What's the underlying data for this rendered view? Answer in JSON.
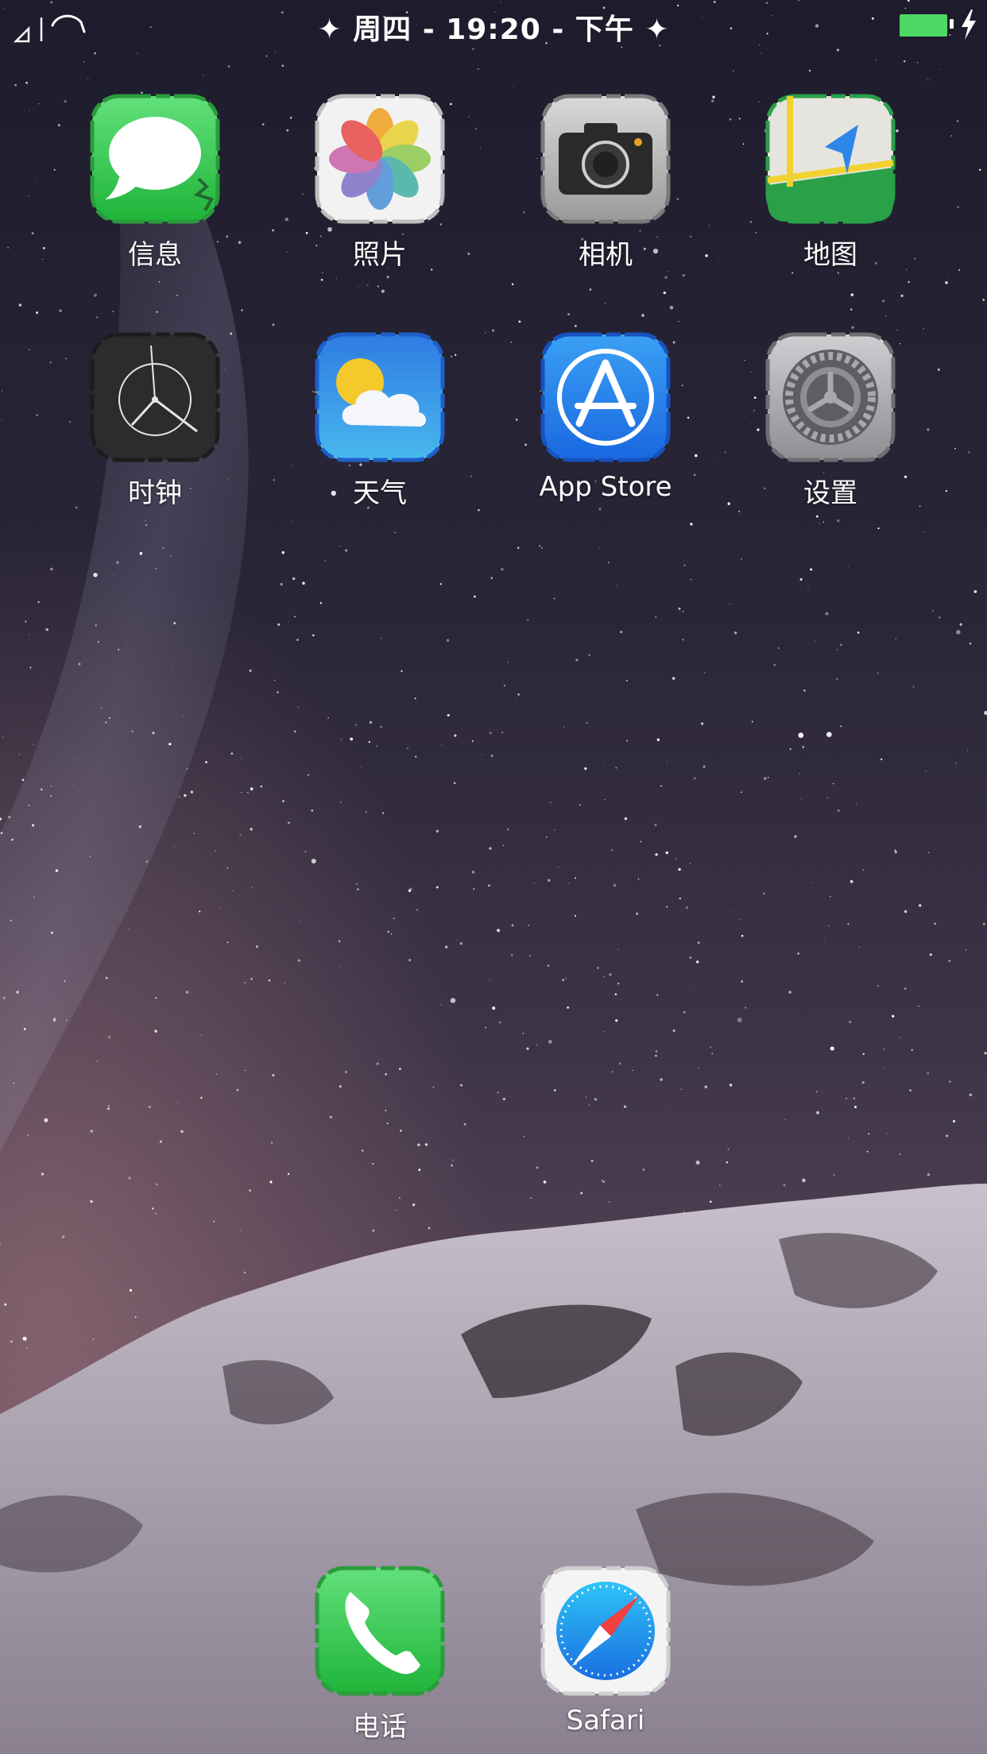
{
  "status_bar": {
    "center_text": "✦ 周四 - 19:20 - 下午 ✦",
    "battery_level": 1.0,
    "battery_color": "#4cd964",
    "icons": [
      "signal-icon",
      "wifi-icon",
      "battery-icon",
      "charging-bolt-icon"
    ]
  },
  "apps": [
    {
      "label": "信息",
      "icon": "messages-icon",
      "frame_color": "#3cc150"
    },
    {
      "label": "照片",
      "icon": "photos-icon",
      "frame_color": "#e8e8e8"
    },
    {
      "label": "相机",
      "icon": "camera-icon",
      "frame_color": "#bdbdbd"
    },
    {
      "label": "地图",
      "icon": "maps-icon",
      "frame_color": "#2eaa4a"
    },
    {
      "label": "时钟",
      "icon": "clock-icon",
      "frame_color": "#333333"
    },
    {
      "label": "天气",
      "icon": "weather-icon",
      "frame_color": "#2f8fe6"
    },
    {
      "label": "App Store",
      "icon": "app-store-icon",
      "frame_color": "#1f7ce6"
    },
    {
      "label": "设置",
      "icon": "settings-icon",
      "frame_color": "#b8b8b8"
    }
  ],
  "dock": [
    {
      "label": "电话",
      "icon": "phone-icon",
      "frame_color": "#3cc150"
    },
    {
      "label": "Safari",
      "icon": "safari-icon",
      "frame_color": "#e8e8e8"
    }
  ]
}
